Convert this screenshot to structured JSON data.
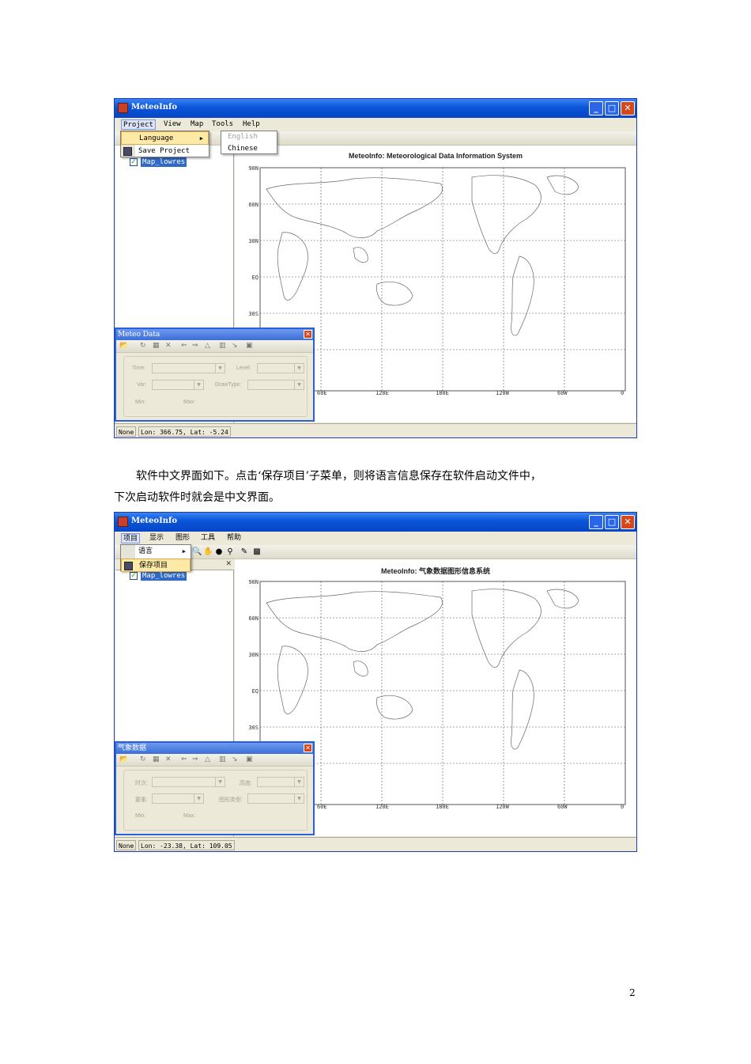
{
  "screenshot1": {
    "title": "MeteoInfo",
    "menu": [
      "Project",
      "View",
      "Map",
      "Tools",
      "Help"
    ],
    "dropdown": {
      "items": [
        {
          "label": "Language",
          "submenu": true
        },
        {
          "label": "Save Project"
        }
      ]
    },
    "submenu": [
      "English",
      "Chinese"
    ],
    "layer": "Map_lowres",
    "map_title": "MeteoInfo: Meteorological Data Information System",
    "float_window": {
      "title": "Meteo Data",
      "labels": {
        "time": "Time:",
        "level": "Level:",
        "var": "Var:",
        "draw_type": "DrawType:",
        "min": "Min:",
        "max": "Max:"
      }
    },
    "status": {
      "left": "None",
      "coords": "Lon: 366.75, Lat: -5.24"
    }
  },
  "paragraph": {
    "line1": "软件中文界面如下。点击‘保存项目’子菜单，则将语言信息保存在软件启动文件中，",
    "line2": "下次启动软件时就会是中文界面。"
  },
  "screenshot2": {
    "title": "MeteoInfo",
    "menu": [
      "项目",
      "显示",
      "图形",
      "工具",
      "帮助"
    ],
    "dropdown": {
      "items": [
        {
          "label": "语言",
          "submenu": true
        },
        {
          "label": "保存项目"
        }
      ]
    },
    "layer": "Map_lowres",
    "map_title": "MeteoInfo: 气象数据图形信息系统",
    "float_window": {
      "title": "气象数据",
      "labels": {
        "time": "时次:",
        "level": "高度:",
        "var": "要素:",
        "draw_type": "图形类型:",
        "min": "Min:",
        "max": "Max:"
      }
    },
    "status": {
      "left": "None",
      "coords": "Lon: -23.38, Lat: 109.05"
    }
  },
  "map": {
    "y_ticks": [
      "90N",
      "60N",
      "30N",
      "EQ",
      "30S"
    ],
    "x_ticks": [
      "60E",
      "120E",
      "180E",
      "120W",
      "60W",
      "0"
    ]
  },
  "page_number": "2"
}
